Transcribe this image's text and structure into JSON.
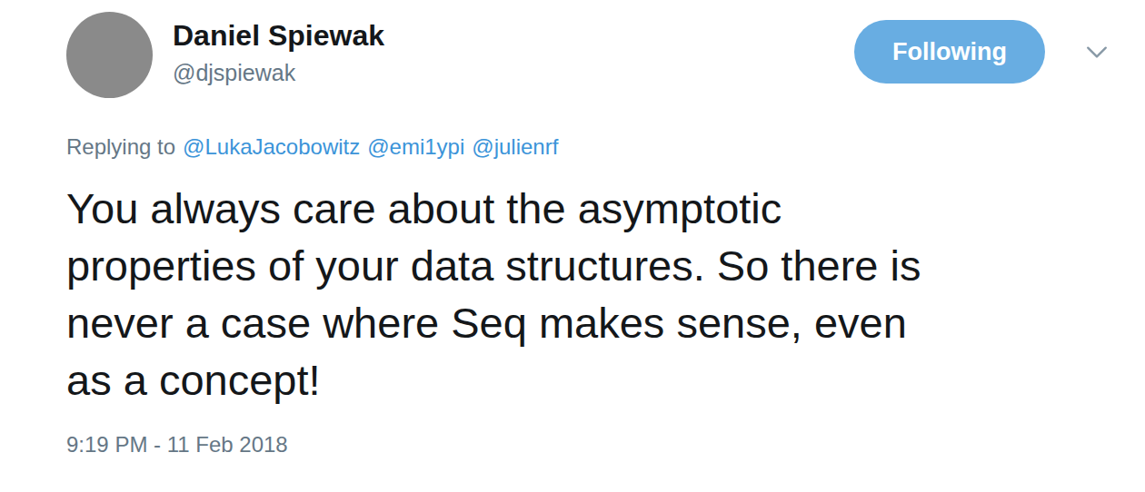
{
  "author": {
    "name": "Daniel Spiewak",
    "handle": "@djspiewak"
  },
  "follow_button": {
    "label": "Following"
  },
  "reply": {
    "prefix": "Replying to",
    "mentions": [
      "@LukaJacobowitz",
      "@emi1ypi",
      "@julienrf"
    ]
  },
  "tweet": {
    "lines": [
      "You always care about the asymptotic",
      "properties of your data structures. So there is",
      "never a case where Seq makes sense, even",
      "as a concept!"
    ]
  },
  "timestamp": "9:19 PM - 11 Feb 2018"
}
